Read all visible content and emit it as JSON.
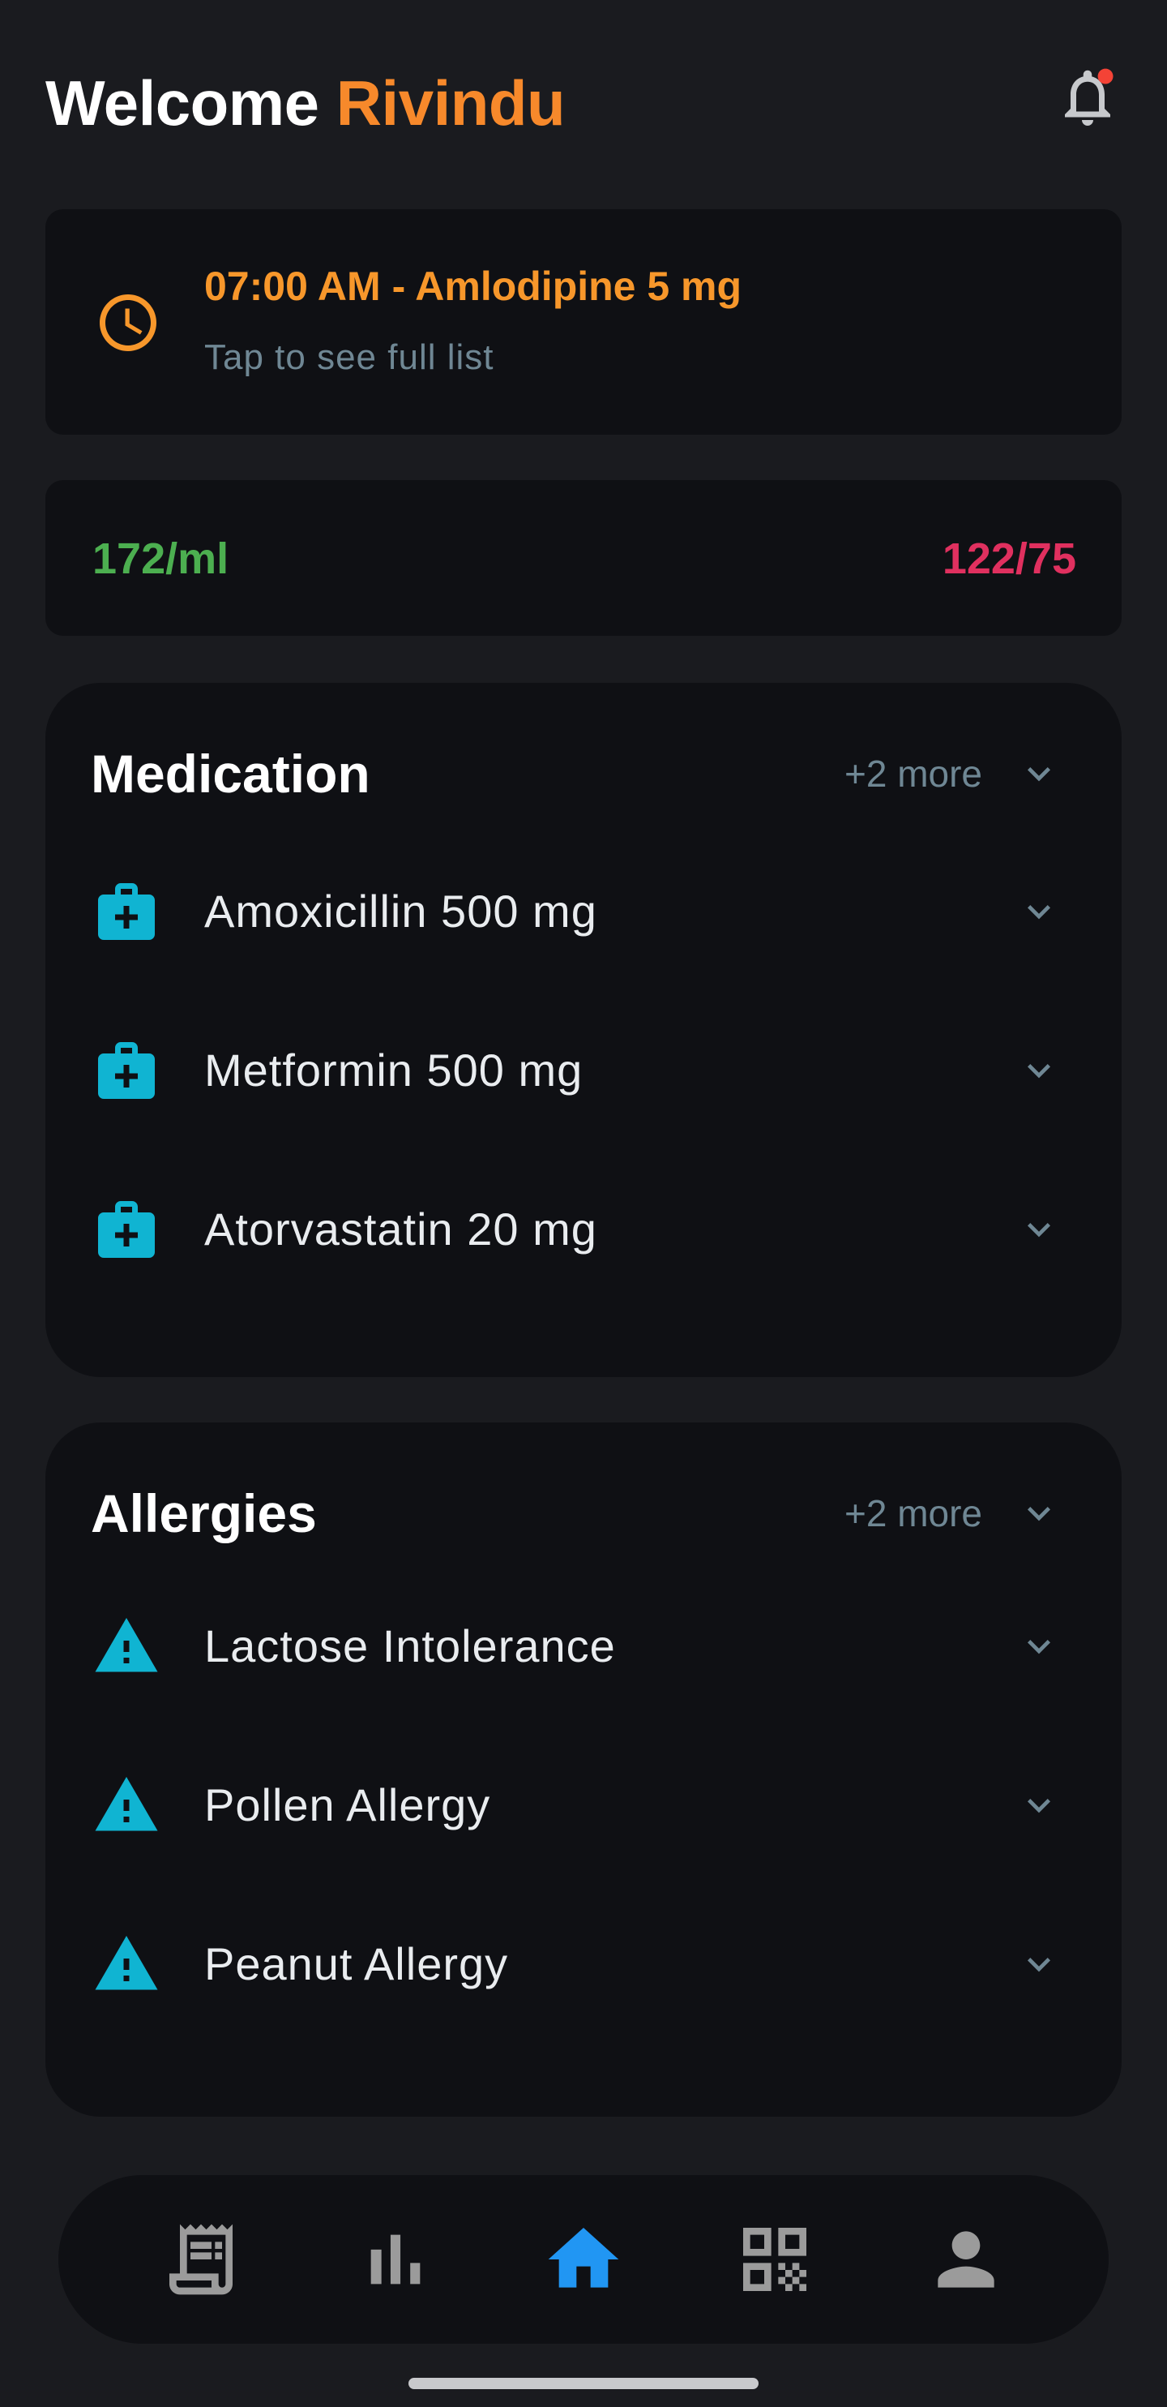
{
  "header": {
    "welcome_label": "Welcome",
    "user_name": "Rivindu",
    "notification_icon": "bell-icon",
    "has_unread_notification": true
  },
  "reminder": {
    "icon": "clock-icon",
    "title": "07:00 AM - Amlodipine 5 mg",
    "subtitle": "Tap to see full list"
  },
  "vitals": {
    "glucose": "172/ml",
    "blood_pressure": "122/75"
  },
  "medication": {
    "title": "Medication",
    "more_label": "+2 more",
    "items": [
      {
        "label": "Amoxicillin 500 mg",
        "icon": "medical-kit-icon"
      },
      {
        "label": "Metformin 500 mg",
        "icon": "medical-kit-icon"
      },
      {
        "label": "Atorvastatin 20 mg",
        "icon": "medical-kit-icon"
      }
    ]
  },
  "allergies": {
    "title": "Allergies",
    "more_label": "+2 more",
    "items": [
      {
        "label": "Lactose Intolerance",
        "icon": "warning-icon"
      },
      {
        "label": "Pollen Allergy",
        "icon": "warning-icon"
      },
      {
        "label": "Peanut Allergy",
        "icon": "warning-icon"
      }
    ]
  },
  "nav": {
    "items": [
      {
        "name": "receipt",
        "icon": "receipt-icon",
        "active": false
      },
      {
        "name": "stats",
        "icon": "bar-chart-icon",
        "active": false
      },
      {
        "name": "home",
        "icon": "home-icon",
        "active": true
      },
      {
        "name": "qr",
        "icon": "qr-code-icon",
        "active": false
      },
      {
        "name": "profile",
        "icon": "person-icon",
        "active": false
      }
    ]
  },
  "colors": {
    "background": "#1a1b1f",
    "card": "#0f1014",
    "accent_orange": "#f7892b",
    "reminder_orange": "#f7972b",
    "glucose_green": "#4caf50",
    "pressure_pink": "#e0305f",
    "muted_text": "#6f8794",
    "icon_cyan": "#10b4d2",
    "nav_active": "#2196f3",
    "nav_inactive": "#9b9b9b",
    "notification_dot": "#f44336"
  }
}
